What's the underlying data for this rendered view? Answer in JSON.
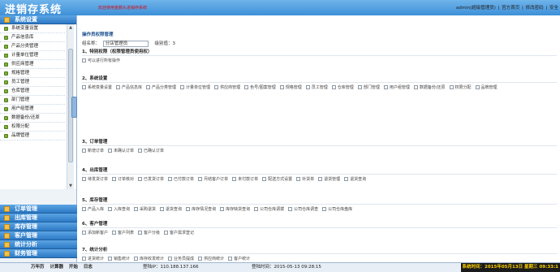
{
  "header": {
    "logo": "进销存系统",
    "welcome": "欢迎使用金鹏头进销存系统",
    "user": "admin(超级管理员)",
    "links": [
      "官方首页",
      "修改密码",
      "安全"
    ]
  },
  "sidebar": {
    "system_menu": "系统设置",
    "items": [
      "系统变量设置",
      "产品信息库",
      "产品分类管理",
      "计量单位管理",
      "供应商管理",
      "规格管理",
      "员工管理",
      "仓库管理",
      "部门管理",
      "用户组管理",
      "数据备份/还原",
      "权限分配",
      "品牌管理"
    ],
    "menus": [
      "订单管理",
      "出库管理",
      "库存管理",
      "客户管理",
      "统计分析",
      "财务管理"
    ]
  },
  "main": {
    "panel_title": "操作员权限管理",
    "role_label": "组名称：",
    "role_value": "分店管理员",
    "level_label": "级别值：3",
    "sections": [
      {
        "title": "1、特别权限（权限管理员使用权）",
        "items": [
          "可以进行所有操作"
        ]
      },
      {
        "title": "2、系统设置",
        "items": [
          "系统变量设置",
          "产品信息库",
          "产品分类管理",
          "计量单位管理",
          "供应商管理",
          "色号/图案管理",
          "规格管理",
          "员工管理",
          "仓库管理",
          "部门管理",
          "用户组管理",
          "数据备份/还原",
          "权限分配",
          "品牌管理"
        ]
      },
      {
        "title": "3、订单管理",
        "items": [
          "新增订单",
          "未确认订单",
          "已确认订单"
        ]
      },
      {
        "title": "4、出库管理",
        "items": [
          "待发货订单",
          "订单核对",
          "已发货订单",
          "已付款订单",
          "月结客户订单",
          "未付款订单",
          "配送方式设置",
          "补货单",
          "退货管理",
          "退货查询"
        ]
      },
      {
        "title": "5、库存管理",
        "items": [
          "产品入库",
          "入库查询",
          "采购退货",
          "退货查询",
          "库存情况查询",
          "库存缺货查询",
          "公司仓库调拨",
          "公司仓库调查",
          "公司仓库盘库"
        ]
      },
      {
        "title": "6、客户管理",
        "items": [
          "添加新客户",
          "客户列表",
          "客户分级",
          "客户需求登记"
        ]
      },
      {
        "title": "7、统计分析",
        "items": [
          "进货统计",
          "销售统计",
          "库存收发统计",
          "业务员提成",
          "供应商统计",
          "客户统计"
        ]
      }
    ]
  },
  "footer": {
    "nav": [
      "万年历",
      "计算器",
      "开始",
      "日志"
    ],
    "ip": "登陆IP：110.188.137.166",
    "login_time": "登陆时间：2015-05-13 09:28:15",
    "clock": "系统时间：2015年05月13日 星期三 09:33:1"
  },
  "colors": {
    "accent": "#3d8fd8",
    "welcome": "#d4111a",
    "clock_bg": "#1a1a1a",
    "clock_text": "#ffd200"
  }
}
